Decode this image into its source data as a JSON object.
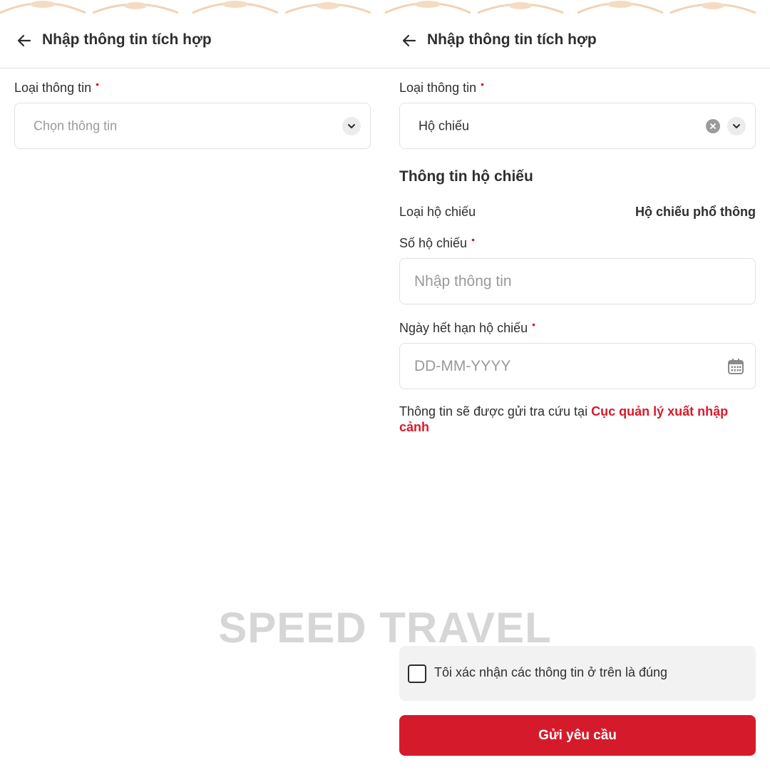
{
  "header": {
    "title": "Nhập thông tin tích hợp"
  },
  "left": {
    "info_type": {
      "label": "Loại thông tin",
      "required_mark": "•",
      "placeholder": "Chọn thông tin"
    }
  },
  "right": {
    "info_type": {
      "label": "Loại thông tin",
      "required_mark": "•",
      "value": "Hộ chiếu"
    },
    "section_title": "Thông tin hộ chiếu",
    "passport_type": {
      "label": "Loại hộ chiếu",
      "value": "Hộ chiếu phổ thông"
    },
    "passport_number": {
      "label": "Số hộ chiếu",
      "required_mark": "•",
      "placeholder": "Nhập thông tin"
    },
    "expiry_date": {
      "label": "Ngày hết hạn hộ chiếu",
      "required_mark": "•",
      "placeholder": "DD-MM-YYYY"
    },
    "notice": {
      "text": "Thông tin sẽ được gửi tra cứu tại ",
      "link": "Cục quản lý xuất nhập cảnh"
    },
    "confirm": {
      "label": "Tôi xác nhận các thông tin ở trên là đúng",
      "checked": false
    },
    "submit": {
      "label": "Gửi yêu cầu"
    }
  },
  "watermark": "SPEED TRAVEL",
  "colors": {
    "accent": "#d51b2b",
    "pattern": "#f1d3b5",
    "border": "#e2e2e2",
    "placeholder": "#9a9a9a"
  },
  "icons": [
    "back-arrow-icon",
    "chevron-down-icon",
    "clear-icon",
    "calendar-icon"
  ]
}
